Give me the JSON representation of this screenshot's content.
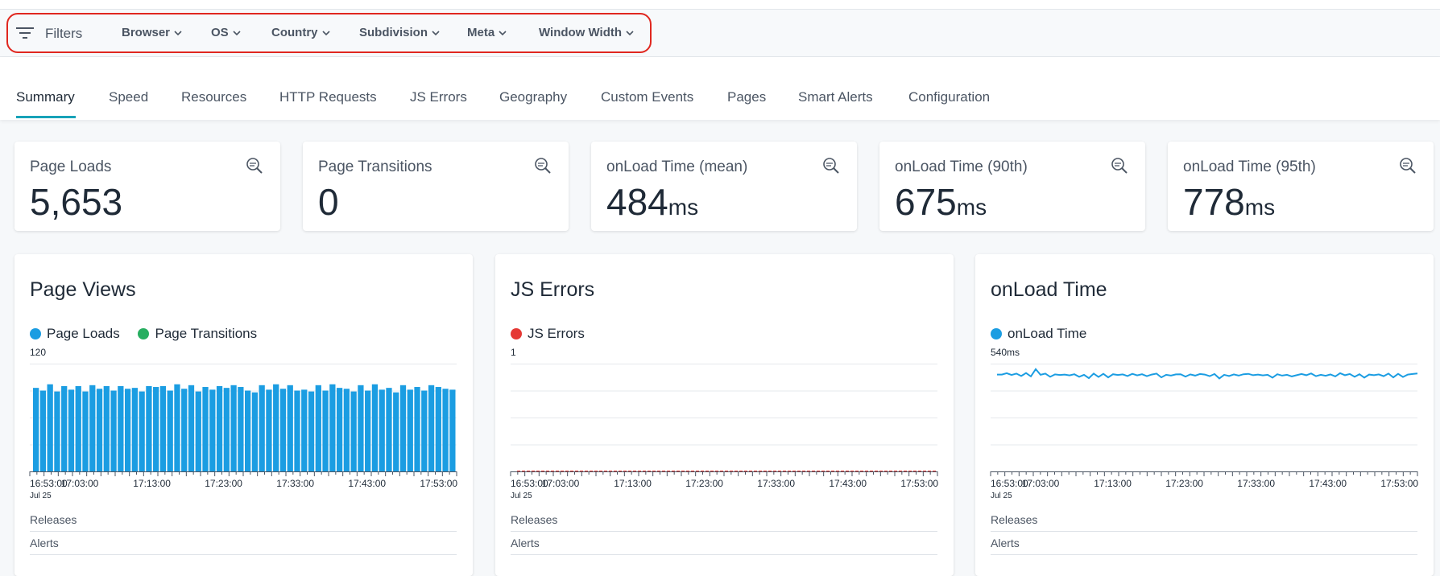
{
  "filters": {
    "label": "Filters",
    "items": [
      "Browser",
      "OS",
      "Country",
      "Subdivision",
      "Meta",
      "Window Width"
    ]
  },
  "tabs": [
    "Summary",
    "Speed",
    "Resources",
    "HTTP Requests",
    "JS Errors",
    "Geography",
    "Custom Events",
    "Pages",
    "Smart Alerts",
    "Configuration"
  ],
  "active_tab": "Summary",
  "kpis": [
    {
      "label": "Page Loads",
      "value": "5,653",
      "unit": ""
    },
    {
      "label": "Page Transitions",
      "value": "0",
      "unit": ""
    },
    {
      "label": "onLoad Time (mean)",
      "value": "484",
      "unit": "ms"
    },
    {
      "label": "onLoad Time (90th)",
      "value": "675",
      "unit": "ms"
    },
    {
      "label": "onLoad Time (95th)",
      "value": "778",
      "unit": "ms"
    }
  ],
  "cards": {
    "page_views": {
      "title": "Page Views",
      "releases": "Releases",
      "alerts": "Alerts"
    },
    "js_errors": {
      "title": "JS Errors",
      "releases": "Releases",
      "alerts": "Alerts"
    },
    "onload": {
      "title": "onLoad Time",
      "releases": "Releases",
      "alerts": "Alerts"
    }
  },
  "colors": {
    "page_loads": "#1b9de2",
    "page_transitions": "#27ae60",
    "js_errors": "#e53935",
    "onload": "#1b9de2",
    "accent": "#17a2b8",
    "highlight": "#e0271f"
  },
  "chart_data": [
    {
      "type": "bar",
      "title": "Page Views",
      "ymax_label": "120",
      "ylim": [
        0,
        120
      ],
      "x_ticks": [
        "16:53:00",
        "17:03:00",
        "17:13:00",
        "17:23:00",
        "17:33:00",
        "17:43:00",
        "17:53:00"
      ],
      "x_date": "Jul 25",
      "series": [
        {
          "name": "Page Loads",
          "values": [
            93,
            90,
            97,
            89,
            95,
            91,
            95,
            89,
            96,
            92,
            95,
            90,
            95,
            92,
            93,
            89,
            95,
            94,
            95,
            90,
            97,
            92,
            96,
            89,
            94,
            91,
            95,
            93,
            96,
            94,
            90,
            88,
            96,
            91,
            97,
            92,
            96,
            90,
            91,
            89,
            96,
            90,
            97,
            93,
            92,
            89,
            96,
            90,
            97,
            91,
            93,
            88,
            96,
            91,
            94,
            90,
            96,
            94,
            92,
            91
          ]
        },
        {
          "name": "Page Transitions",
          "values": [
            0,
            0,
            0,
            0,
            0,
            0,
            0,
            0,
            0,
            0,
            0,
            0,
            0,
            0,
            0,
            0,
            0,
            0,
            0,
            0,
            0,
            0,
            0,
            0,
            0,
            0,
            0,
            0,
            0,
            0,
            0,
            0,
            0,
            0,
            0,
            0,
            0,
            0,
            0,
            0,
            0,
            0,
            0,
            0,
            0,
            0,
            0,
            0,
            0,
            0,
            0,
            0,
            0,
            0,
            0,
            0,
            0,
            0,
            0,
            0
          ]
        }
      ]
    },
    {
      "type": "line",
      "title": "JS Errors",
      "ymax_label": "1",
      "ylim": [
        0,
        1
      ],
      "x_ticks": [
        "16:53:00",
        "17:03:00",
        "17:13:00",
        "17:23:00",
        "17:33:00",
        "17:43:00",
        "17:53:00"
      ],
      "x_date": "Jul 25",
      "series": [
        {
          "name": "JS Errors",
          "values": [
            0,
            0,
            0,
            0,
            0,
            0,
            0,
            0,
            0,
            0,
            0,
            0,
            0,
            0,
            0,
            0,
            0,
            0,
            0,
            0,
            0,
            0,
            0,
            0,
            0,
            0,
            0,
            0,
            0,
            0,
            0,
            0,
            0,
            0,
            0,
            0,
            0,
            0,
            0,
            0,
            0,
            0,
            0,
            0,
            0,
            0,
            0,
            0,
            0,
            0,
            0,
            0,
            0,
            0,
            0,
            0,
            0,
            0,
            0,
            0
          ]
        }
      ]
    },
    {
      "type": "line",
      "title": "onLoad Time",
      "ymax_label": "540ms",
      "ylim": [
        0,
        540
      ],
      "x_ticks": [
        "16:53:00",
        "17:03:00",
        "17:13:00",
        "17:23:00",
        "17:33:00",
        "17:43:00",
        "17:53:00"
      ],
      "x_date": "Jul 25",
      "series": [
        {
          "name": "onLoad Time",
          "values": [
            485,
            485,
            492,
            483,
            490,
            478,
            493,
            476,
            512,
            484,
            490,
            474,
            486,
            483,
            485,
            481,
            487,
            474,
            484,
            467,
            490,
            473,
            489,
            471,
            487,
            483,
            486,
            478,
            489,
            481,
            487,
            477,
            485,
            490,
            471,
            484,
            480,
            486,
            487,
            475,
            486,
            480,
            488,
            485,
            477,
            488,
            466,
            484,
            478,
            486,
            480,
            487,
            489,
            482,
            485,
            481,
            484,
            470,
            487,
            480,
            484,
            476,
            482,
            488,
            482,
            491,
            477,
            484,
            479,
            486,
            476,
            492,
            482,
            488,
            474,
            487,
            470,
            485,
            482,
            486,
            477,
            490,
            471,
            489,
            473,
            485,
            488,
            491
          ]
        }
      ]
    }
  ]
}
